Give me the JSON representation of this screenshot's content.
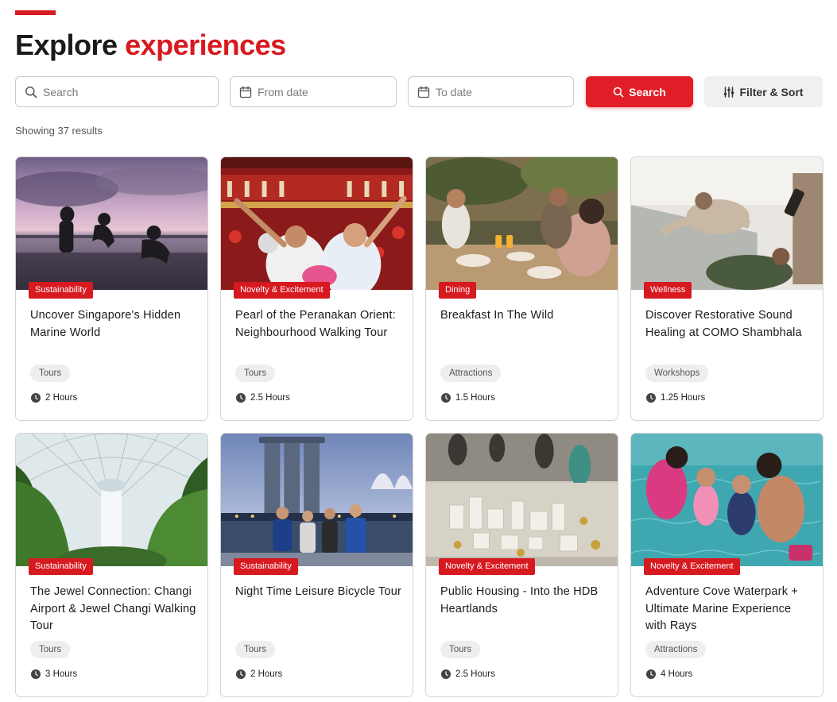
{
  "header": {
    "title_prefix": "Explore",
    "title_highlight": "experiences"
  },
  "search_bar": {
    "search_placeholder": "Search",
    "from_date_placeholder": "From date",
    "to_date_placeholder": "To date",
    "search_button_label": "Search",
    "filter_button_label": "Filter & Sort"
  },
  "results": {
    "count_text": "Showing 37 results"
  },
  "colors": {
    "accent": "#d71920",
    "search_button": "#e11d27"
  },
  "cards": [
    {
      "category": "Sustainability",
      "title": "Uncover Singapore's Hidden Marine World",
      "tag": "Tours",
      "duration": "2 Hours"
    },
    {
      "category": "Novelty & Excitement",
      "title": "Pearl of the Peranakan Orient: Neighbourhood Walking Tour",
      "tag": "Tours",
      "duration": "2.5 Hours"
    },
    {
      "category": "Dining",
      "title": "Breakfast In The Wild",
      "tag": "Attractions",
      "duration": "1.5 Hours"
    },
    {
      "category": "Wellness",
      "title": "Discover Restorative Sound Healing at COMO Shambhala",
      "tag": "Workshops",
      "duration": "1.25 Hours"
    },
    {
      "category": "Sustainability",
      "title": "The Jewel Connection: Changi Airport & Jewel Changi Walking Tour",
      "tag": "Tours",
      "duration": "3 Hours"
    },
    {
      "category": "Sustainability",
      "title": "Night Time Leisure Bicycle Tour",
      "tag": "Tours",
      "duration": "2 Hours"
    },
    {
      "category": "Novelty & Excitement",
      "title": "Public Housing - Into the HDB Heartlands",
      "tag": "Tours",
      "duration": "2.5 Hours"
    },
    {
      "category": "Novelty & Excitement",
      "title": "Adventure Cove Waterpark + Ultimate Marine Experience with Rays",
      "tag": "Attractions",
      "duration": "4 Hours"
    }
  ]
}
